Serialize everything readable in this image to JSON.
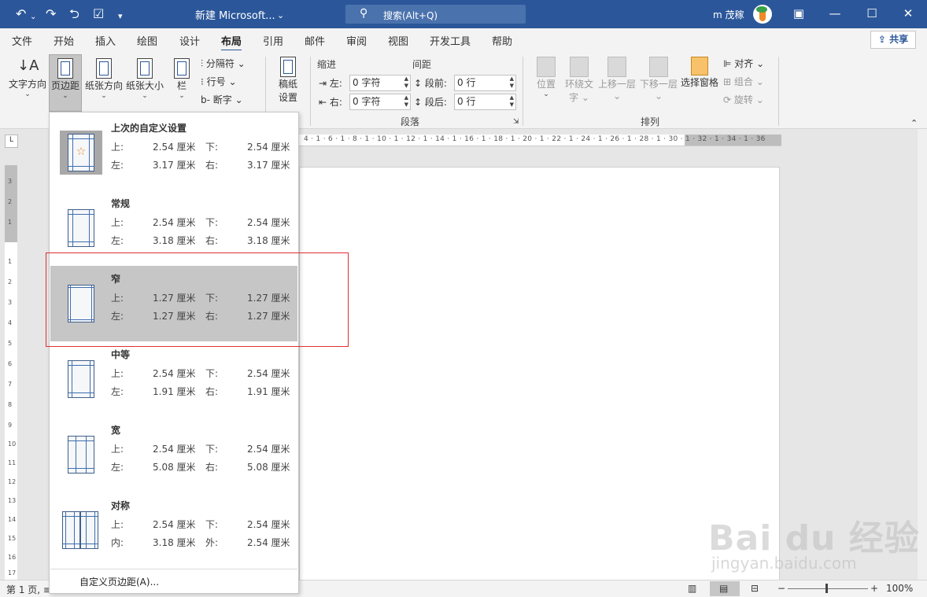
{
  "titlebar": {
    "doc_title": "新建 Microsoft...",
    "title_caret": "⌄",
    "search_placeholder": "搜索(Alt+Q)",
    "user_name": "m 茂稼",
    "undo": "↶",
    "undo_caret": "⌄",
    "redo": "↷",
    "repeat": "⮌",
    "form": "☑",
    "customize": "▾",
    "btn_restore_ribbon": "▣",
    "btn_min": "—",
    "btn_max": "☐",
    "btn_close": "✕"
  },
  "tabs": [
    "文件",
    "开始",
    "插入",
    "绘图",
    "设计",
    "布局",
    "引用",
    "邮件",
    "审阅",
    "视图",
    "开发工具",
    "帮助"
  ],
  "active_tab": "布局",
  "share_label": "共享",
  "ribbon": {
    "text_direction": "文字方向",
    "margins": "页边距",
    "orientation": "纸张方向",
    "size": "纸张大小",
    "columns": "栏",
    "breaks": "分隔符 ⌄",
    "line_numbers": "行号 ⌄",
    "hyphenation": "断字 ⌄",
    "paper_setting_line1": "稿纸",
    "paper_setting_line2": "设置",
    "indent_title": "缩进",
    "spacing_title": "间距",
    "indent_left_label": "左:",
    "indent_left_value": "0 字符",
    "indent_right_label": "右:",
    "indent_right_value": "0 字符",
    "space_before_label": "段前:",
    "space_before_value": "0 行",
    "space_after_label": "段后:",
    "space_after_value": "0 行",
    "paragraph_group": "段落",
    "position": "位置",
    "wrap_text_line1": "环绕文",
    "wrap_text_line2": "字 ⌄",
    "bring_forward": "上移一层 ⌄",
    "send_backward": "下移一层 ⌄",
    "selection_pane": "选择窗格",
    "align": "对齐 ⌄",
    "group": "组合 ⌄",
    "rotate": "旋转 ⌄",
    "arrange_group": "排列"
  },
  "ruler": {
    "horizontal": "4 · 1 · 6 · 1 · 8 · 1 · 10 · 1 · 12 · 1 · 14 · 1 · 16 · 1 · 18 · 1 · 20 · 1 · 22 · 1 · 24 · 1 · 26 · 1 · 28 · 1 · 30 · 1 · 32 · 1 · 34 · 1 · 36",
    "corner": "L",
    "vertical": [
      "3",
      "2",
      "1",
      "1",
      "2",
      "3",
      "4",
      "5",
      "6",
      "7",
      "8",
      "9",
      "10",
      "11",
      "12",
      "13",
      "14",
      "15",
      "16",
      "17"
    ]
  },
  "margins_menu": {
    "options": [
      {
        "name": "上次的自定义设置",
        "l1": "上:",
        "v1": "2.54 厘米",
        "l2": "下:",
        "v2": "2.54 厘米",
        "l3": "左:",
        "v3": "3.17 厘米",
        "l4": "右:",
        "v4": "3.17 厘米"
      },
      {
        "name": "常规",
        "l1": "上:",
        "v1": "2.54 厘米",
        "l2": "下:",
        "v2": "2.54 厘米",
        "l3": "左:",
        "v3": "3.18 厘米",
        "l4": "右:",
        "v4": "3.18 厘米"
      },
      {
        "name": "窄",
        "l1": "上:",
        "v1": "1.27 厘米",
        "l2": "下:",
        "v2": "1.27 厘米",
        "l3": "左:",
        "v3": "1.27 厘米",
        "l4": "右:",
        "v4": "1.27 厘米"
      },
      {
        "name": "中等",
        "l1": "上:",
        "v1": "2.54 厘米",
        "l2": "下:",
        "v2": "2.54 厘米",
        "l3": "左:",
        "v3": "1.91 厘米",
        "l4": "右:",
        "v4": "1.91 厘米"
      },
      {
        "name": "宽",
        "l1": "上:",
        "v1": "2.54 厘米",
        "l2": "下:",
        "v2": "2.54 厘米",
        "l3": "左:",
        "v3": "5.08 厘米",
        "l4": "右:",
        "v4": "5.08 厘米"
      },
      {
        "name": "对称",
        "l1": "上:",
        "v1": "2.54 厘米",
        "l2": "下:",
        "v2": "2.54 厘米",
        "l3": "内:",
        "v3": "3.18 厘米",
        "l4": "外:",
        "v4": "2.54 厘米"
      }
    ],
    "highlighted": "窄",
    "custom_label": "自定义页边距(A)..."
  },
  "status": {
    "page": "第 1 页, ≡",
    "zoom": "100%",
    "zoom_minus": "−",
    "zoom_plus": "+",
    "read_mode": "▥",
    "print_layout": "▤",
    "web_layout": "⊟"
  },
  "watermark": {
    "line1": "Bai du 经验",
    "line2": "jingyan.baidu.com"
  },
  "colors": {
    "titlebar": "#2b579a",
    "highlight": "#c6c6c6",
    "annotation_box": "#e03030"
  }
}
